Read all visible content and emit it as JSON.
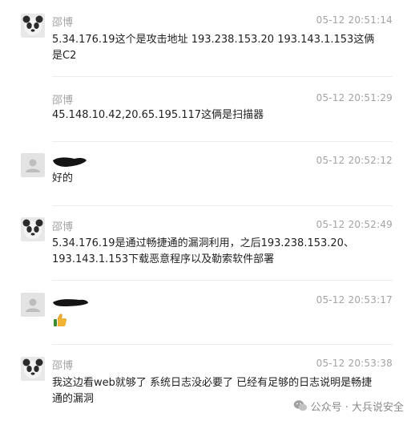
{
  "messages": [
    {
      "sender": "邵博",
      "time": "05-12 20:51:14",
      "text": "5.34.176.19这个是攻击地址  193.238.153.20 193.143.1.153这俩是C2",
      "avatar": "panda-avatar"
    },
    {
      "sender": "邵博",
      "time": "05-12 20:51:29",
      "text": "45.148.10.42,20.65.195.117这俩是扫描器",
      "avatar": "none"
    },
    {
      "sender": "",
      "time": "05-12 20:52:12",
      "text": "好的",
      "avatar": "default-user-avatar"
    },
    {
      "sender": "邵博",
      "time": "05-12 20:52:49",
      "text": "5.34.176.19是通过畅捷通的漏洞利用，之后193.238.153.20、193.143.1.153下载恶意程序以及勒索软件部署",
      "avatar": "panda-avatar"
    },
    {
      "sender": "",
      "time": "05-12 20:53:17",
      "text": "",
      "avatar": "default-user-avatar",
      "emoji": "thumbs-up-icon"
    },
    {
      "sender": "邵博",
      "time": "05-12 20:53:38",
      "text": "我这边看web就够了 系统日志没必要了 已经有足够的日志说明是畅捷通的漏洞",
      "avatar": "panda-avatar"
    }
  ],
  "watermark": {
    "text": "公众号 · 大兵说安全",
    "icon": "wechat-icon"
  },
  "colors": {
    "meta": "#a3a3a3",
    "text": "#1f1f1f",
    "divider": "#ececec"
  }
}
